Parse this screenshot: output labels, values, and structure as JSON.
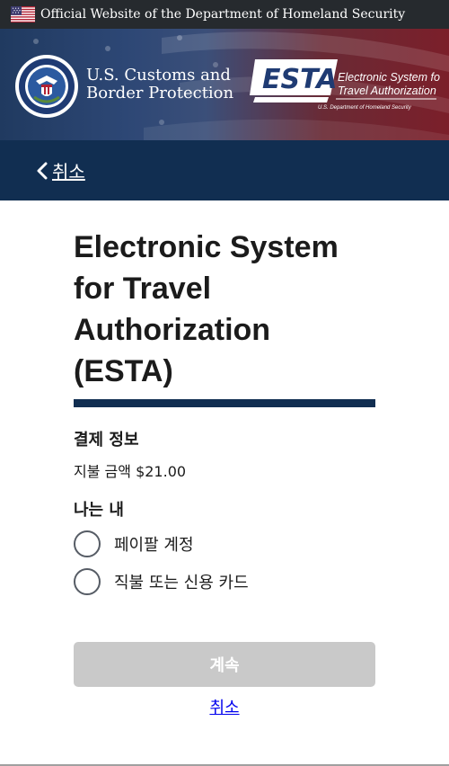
{
  "gov_banner": {
    "text": "Official Website of the Department of Homeland Security",
    "flag_icon": "us-flag-icon"
  },
  "header": {
    "seal_icon": "dhs-seal-icon",
    "cbp_line1": "U.S. Customs and",
    "cbp_line2": "Border Protection",
    "esta_logo_word": "ESTA",
    "esta_tagline_line1": "Electronic System for",
    "esta_tagline_line2": "Travel Authorization",
    "esta_subtitle": "U.S. Department of Homeland Security"
  },
  "nav": {
    "back_label": "취소",
    "back_icon": "chevron-left-icon"
  },
  "main": {
    "title": "Electronic System for Travel Authorization (ESTA)",
    "section_heading": "결제 정보",
    "amount_label": "지불 금액",
    "amount_value": "$21.00",
    "payment_heading": "나는 내",
    "options": [
      {
        "label": "페이팔 계정"
      },
      {
        "label": "직불 또는 신용 카드"
      }
    ]
  },
  "actions": {
    "continue_label": "계속",
    "cancel_label": "취소"
  },
  "colors": {
    "banner_bg": "#262a2e",
    "nav_bg": "#112e51",
    "title_rule": "#112e51",
    "button_disabled": "#c9c9c9",
    "link": "#0000ee"
  }
}
